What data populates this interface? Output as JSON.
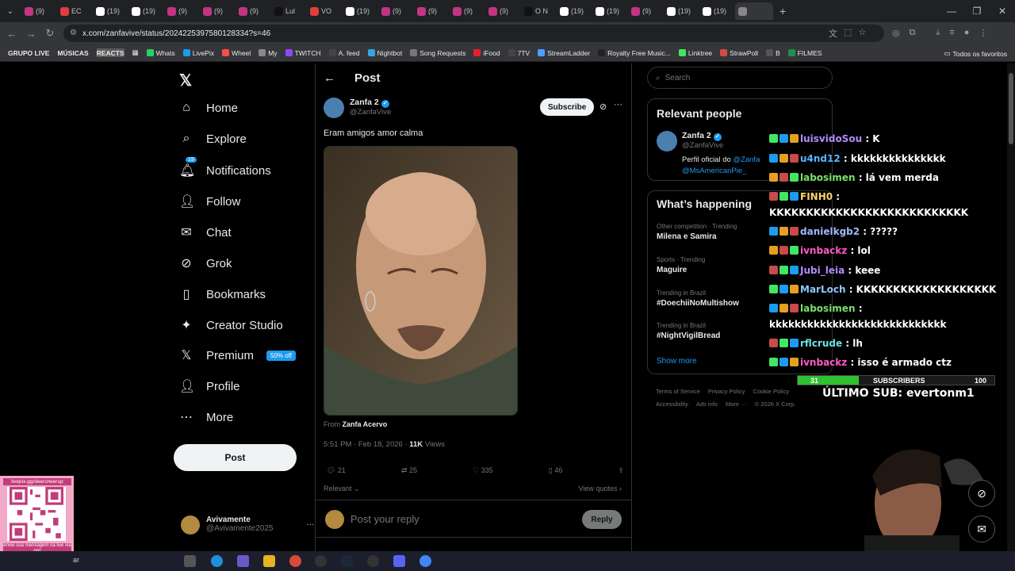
{
  "browser": {
    "tabs": [
      "(9)",
      "EC",
      "(19)",
      "(19)",
      "(9)",
      "(9)",
      "(9)",
      "Lul",
      "VO",
      "(19)",
      "(9)",
      "(9)",
      "(9)",
      "(9)",
      "O N",
      "(19)",
      "(19)",
      "(9)",
      "(19)",
      "(19)",
      ""
    ],
    "url": "x.com/zanfavive/status/2024225397580128334?s=46",
    "bookmarks": [
      "GRUPO LIVE",
      "MÚSICAS",
      "REACTS",
      "Whats",
      "LivePix",
      "Wheel",
      "My",
      "TWITCH",
      "A. feed",
      "Nightbot",
      "Song Requests",
      "iFood",
      "7TV",
      "StreamLadder",
      "Royalty Free Music...",
      "Linktree",
      "StrawPoll",
      "B",
      "FILMES"
    ],
    "all_bookmarks": "Todos os favoritos"
  },
  "nav": {
    "items": [
      "Home",
      "Explore",
      "Notifications",
      "Follow",
      "Chat",
      "Grok",
      "Bookmarks",
      "Creator Studio",
      "Premium",
      "Profile",
      "More"
    ],
    "notif_badge": "19",
    "premium_pill": "50% off",
    "post_button": "Post",
    "account": {
      "name": "Avivamente",
      "handle": "@Avivamente2025"
    }
  },
  "post": {
    "header": "Post",
    "author_name": "Zanfa 2",
    "author_handle": "@ZanfaVive",
    "subscribe": "Subscribe",
    "text": "Eram amigos amor calma",
    "from_prefix": "From",
    "from_source": "Zanfa Acervo",
    "time": "5:51 PM · Feb 18, 2026 ·",
    "views_count": "11K",
    "views_label": "Views",
    "replies": "21",
    "reposts": "25",
    "likes": "335",
    "bookmarks": "46",
    "relevant": "Relevant",
    "view_quotes": "View quotes",
    "reply_placeholder": "Post your reply",
    "reply_button": "Reply"
  },
  "sidebar": {
    "search_placeholder": "Search",
    "relevant_title": "Relevant people",
    "rp_name": "Zanfa 2",
    "rp_handle": "@ZanfaVive",
    "rp_bio_prefix": "Perfil oficial do",
    "rp_bio_link1": "@Zanfa",
    "rp_bio_link2": "@MsAmericanPie_",
    "happening_title": "What’s happening",
    "trends": [
      {
        "context": "Other competition · Trending",
        "name": "Milena e Samira"
      },
      {
        "context": "Sports · Trending",
        "name": "Maguire"
      },
      {
        "context": "Trending in Brazil",
        "name": "#DoechiiNoMultishow"
      },
      {
        "context": "Trending in Brazil",
        "name": "#NightVigilBread"
      }
    ],
    "show_more": "Show more",
    "footer": [
      "Terms of Service",
      "Privacy Policy",
      "Cookie Policy",
      "Accessibility",
      "Ads info",
      "More ···",
      "© 2026 X Corp."
    ]
  },
  "stream_chat": [
    {
      "user": "luisvidoSou",
      "msg": ": K",
      "color": "#b38bff"
    },
    {
      "user": "u4nd12",
      "msg": ": kkkkkkkkkkkkkkk",
      "color": "#5ab4ff"
    },
    {
      "user": "labosimen",
      "msg": ": lá vem merda",
      "color": "#7be06b"
    },
    {
      "user": "FINH0",
      "msg": ":",
      "color": "#ffd36b"
    },
    {
      "user": "",
      "msg": "KKKKKKKKKKKKKKKKKKKKKKKKKKK",
      "color": "#ffffff"
    },
    {
      "user": "danielkgb2",
      "msg": ": ?????",
      "color": "#a0b8ff"
    },
    {
      "user": "ivnbackz",
      "msg": ": lol",
      "color": "#ff5ac0"
    },
    {
      "user": "Jubi_leia",
      "msg": ": keee",
      "color": "#b38bff"
    },
    {
      "user": "MarLoch",
      "msg": ": KKKKKKKKKKKKKKKKKKK",
      "color": "#8ec8ff"
    },
    {
      "user": "labosimen",
      "msg": ":",
      "color": "#7be06b"
    },
    {
      "user": "",
      "msg": "kkkkkkkkkkkkkkkkkkkkkkkkkkkk",
      "color": "#ffffff"
    },
    {
      "user": "rflcrude",
      "msg": ": lh",
      "color": "#6ee0e0"
    },
    {
      "user": "ivnbackz",
      "msg": ": isso é armado ctz",
      "color": "#ff5ac0"
    }
  ],
  "overlay": {
    "sub_current": "31",
    "sub_label": "SUBSCRIBERS",
    "sub_goal": "100",
    "sub_fraction": 0.31,
    "last_sub": "ÚLTIMO SUB: evertonm1",
    "qr_top": "livepix.gg/deercheerup",
    "qr_bottom": "envie sua mensagem na live via pix!"
  },
  "taskbar": {
    "search_text": "ar"
  },
  "colors": {
    "accent": "#1d9bf0",
    "background": "#000000",
    "chat_bar": "#2fbf2f"
  }
}
